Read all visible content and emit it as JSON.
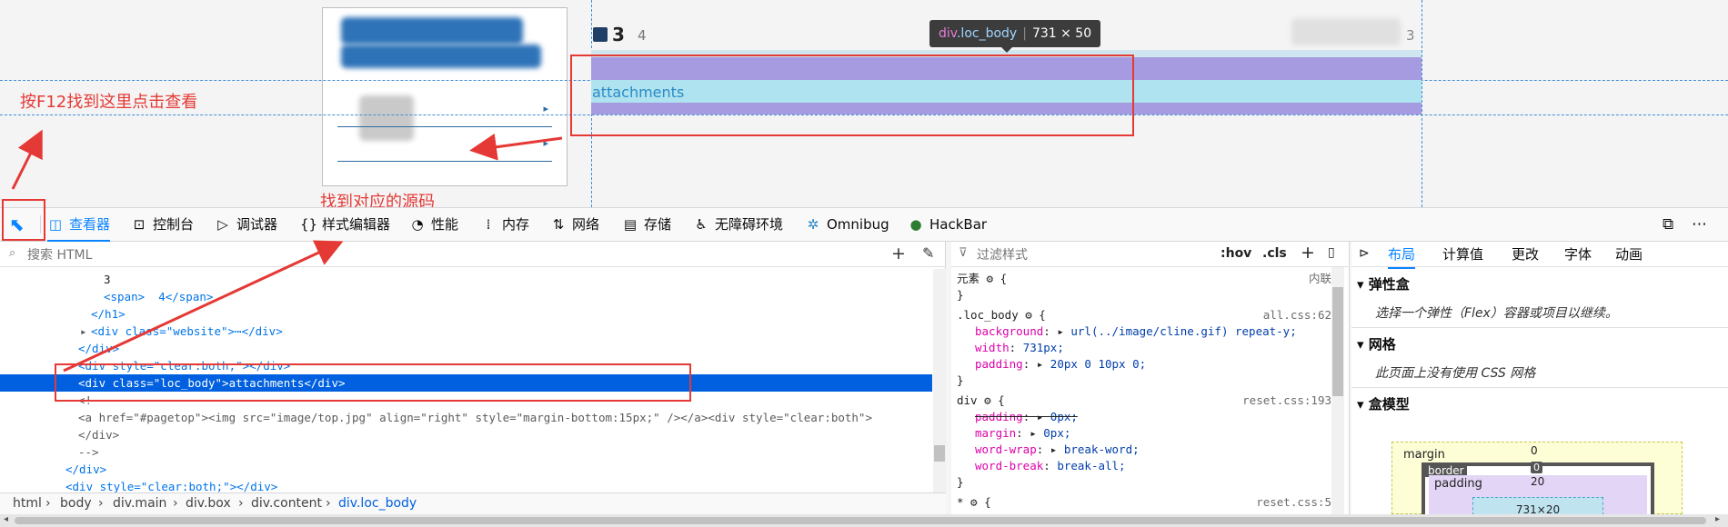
{
  "page": {
    "header_number": "3",
    "header_small": "4",
    "right_number": "3",
    "attachments_label": "attachments"
  },
  "tooltip": {
    "tag": "div",
    "cls": ".loc_body",
    "size": "731 × 50"
  },
  "annotations": {
    "f12_note": "按F12找到这里点击查看",
    "source_note": "找到对应的源码"
  },
  "toolbar": {
    "items": [
      {
        "label": "查看器",
        "icon": "inspector-icon"
      },
      {
        "label": "控制台",
        "icon": "console-icon"
      },
      {
        "label": "调试器",
        "icon": "debugger-icon"
      },
      {
        "label": "样式编辑器",
        "icon": "style-editor-icon"
      },
      {
        "label": "性能",
        "icon": "performance-icon"
      },
      {
        "label": "内存",
        "icon": "memory-icon"
      },
      {
        "label": "网络",
        "icon": "network-icon"
      },
      {
        "label": "存储",
        "icon": "storage-icon"
      },
      {
        "label": "无障碍环境",
        "icon": "accessibility-icon"
      },
      {
        "label": "Omnibug",
        "icon": "omnibug-icon"
      },
      {
        "label": "HackBar",
        "icon": "hackbar-icon"
      }
    ]
  },
  "inspector": {
    "search_placeholder": "搜索 HTML",
    "lines": [
      "3",
      "<span>  4</span>",
      "</h1>",
      "<div class=\"website\">⋯</div>",
      "</div>",
      "<div style=\"clear:both;\"></div>",
      "<div class=\"loc_body\">attachments</div>",
      "<!--",
      "<a href=\"#pagetop\"><img src=\"image/top.jpg\" align=\"right\" style=\"margin-bottom:15px;\" /></a><div style=\"clear:both\">",
      "</div>",
      "-->",
      "</div>",
      "<div style=\"clear:both;\"></div>"
    ],
    "breadcrumbs": [
      "html",
      "body",
      "div.main",
      "div.box",
      "div.content",
      "div.loc_body"
    ]
  },
  "rules": {
    "filter_placeholder": "过滤样式",
    "hov": ":hov",
    "cls": ".cls",
    "element_label": "元素",
    "inline_label": "内联",
    "loc_body_selector": ".loc_body",
    "loc_body_source": "all.css:62",
    "loc_body_props": [
      {
        "name": "background",
        "value": "url(../image/cline.gif) repeat-y;"
      },
      {
        "name": "width",
        "value": "731px;"
      },
      {
        "name": "padding",
        "value": "20px 0 10px 0;"
      }
    ],
    "div_selector": "div",
    "div_source": "reset.css:193",
    "div_props": [
      {
        "name": "padding",
        "value": "0px;"
      },
      {
        "name": "margin",
        "value": "0px;"
      },
      {
        "name": "word-wrap",
        "value": "break-word;"
      },
      {
        "name": "word-break",
        "value": "break-all;"
      }
    ],
    "star_selector": "*",
    "star_source": "reset.css:5"
  },
  "layout_panel": {
    "tabs": [
      "布局",
      "计算值",
      "更改",
      "字体",
      "动画"
    ],
    "flex_title": "弹性盒",
    "flex_body": "选择一个弹性（Flex）容器或项目以继续。",
    "grid_title": "网格",
    "grid_body": "此页面上没有使用 CSS 网格",
    "boxmodel_title": "盒模型",
    "box_margin_label": "margin",
    "box_margin_top": "0",
    "box_border_label": "border",
    "box_border_top": "0",
    "box_padding_label": "padding",
    "box_padding_top": "20",
    "box_content": "731×20"
  },
  "colors": {
    "accent": "#0a84ff",
    "annotation_red": "#e53935",
    "highlight_purple": "#a69be0",
    "highlight_blue": "#aee3ef"
  }
}
